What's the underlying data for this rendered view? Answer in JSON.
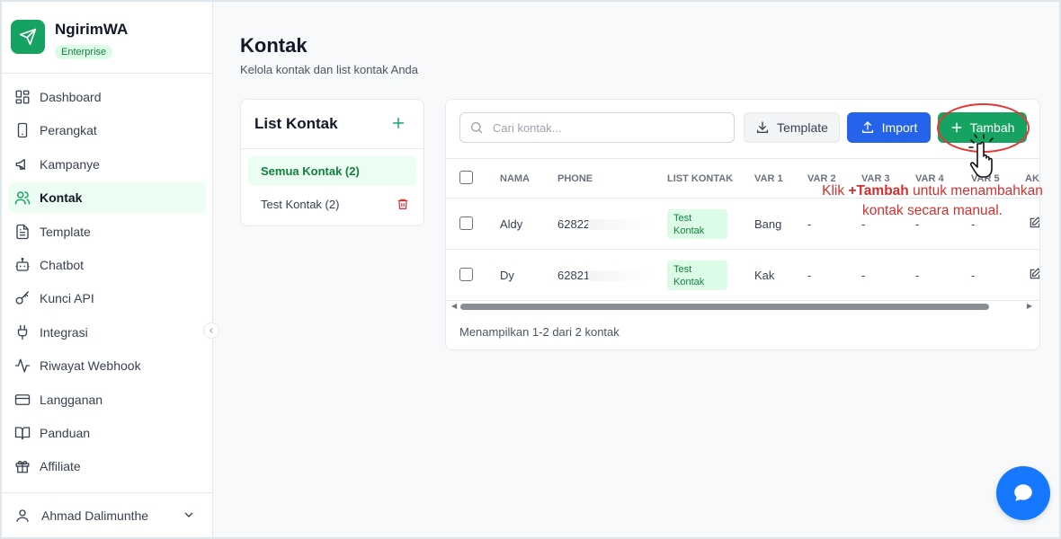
{
  "brand": {
    "name": "NgirimWA",
    "plan": "Enterprise"
  },
  "nav": {
    "items": [
      {
        "label": "Dashboard"
      },
      {
        "label": "Perangkat"
      },
      {
        "label": "Kampanye"
      },
      {
        "label": "Kontak"
      },
      {
        "label": "Template"
      },
      {
        "label": "Chatbot"
      },
      {
        "label": "Kunci API"
      },
      {
        "label": "Integrasi"
      },
      {
        "label": "Riwayat Webhook"
      },
      {
        "label": "Langganan"
      },
      {
        "label": "Panduan"
      },
      {
        "label": "Affiliate"
      }
    ],
    "active": "Kontak"
  },
  "user": {
    "name": "Ahmad Dalimunthe"
  },
  "page": {
    "title": "Kontak",
    "subtitle": "Kelola kontak dan list kontak Anda"
  },
  "list_kontak": {
    "title": "List Kontak",
    "items": [
      {
        "label": "Semua Kontak (2)"
      },
      {
        "label": "Test Kontak (2)"
      }
    ]
  },
  "toolbar": {
    "search_placeholder": "Cari kontak...",
    "template_label": "Template",
    "import_label": "Import",
    "tambah_label": "Tambah"
  },
  "table": {
    "headers": [
      "NAMA",
      "PHONE",
      "LIST KONTAK",
      "VAR 1",
      "VAR 2",
      "VAR 3",
      "VAR 4",
      "VAR 5",
      "AKSI"
    ],
    "rows": [
      {
        "nama": "Aldy",
        "phone": "62822",
        "list": "Test Kontak",
        "var1": "Bang",
        "var2": "-",
        "var3": "-",
        "var4": "-",
        "var5": "-"
      },
      {
        "nama": "Dy",
        "phone": "62821",
        "list": "Test Kontak",
        "var1": "Kak",
        "var2": "-",
        "var3": "-",
        "var4": "-",
        "var5": "-"
      }
    ],
    "footer": "Menampilkan 1-2 dari 2 kontak"
  },
  "annotation": {
    "prefix": "Klik ",
    "bold": "+Tambah",
    "suffix": " untuk menambahkan kontak secara manual."
  },
  "colors": {
    "accent": "#16a361",
    "primary": "#2563eb",
    "annotation": "#d32f2f"
  }
}
